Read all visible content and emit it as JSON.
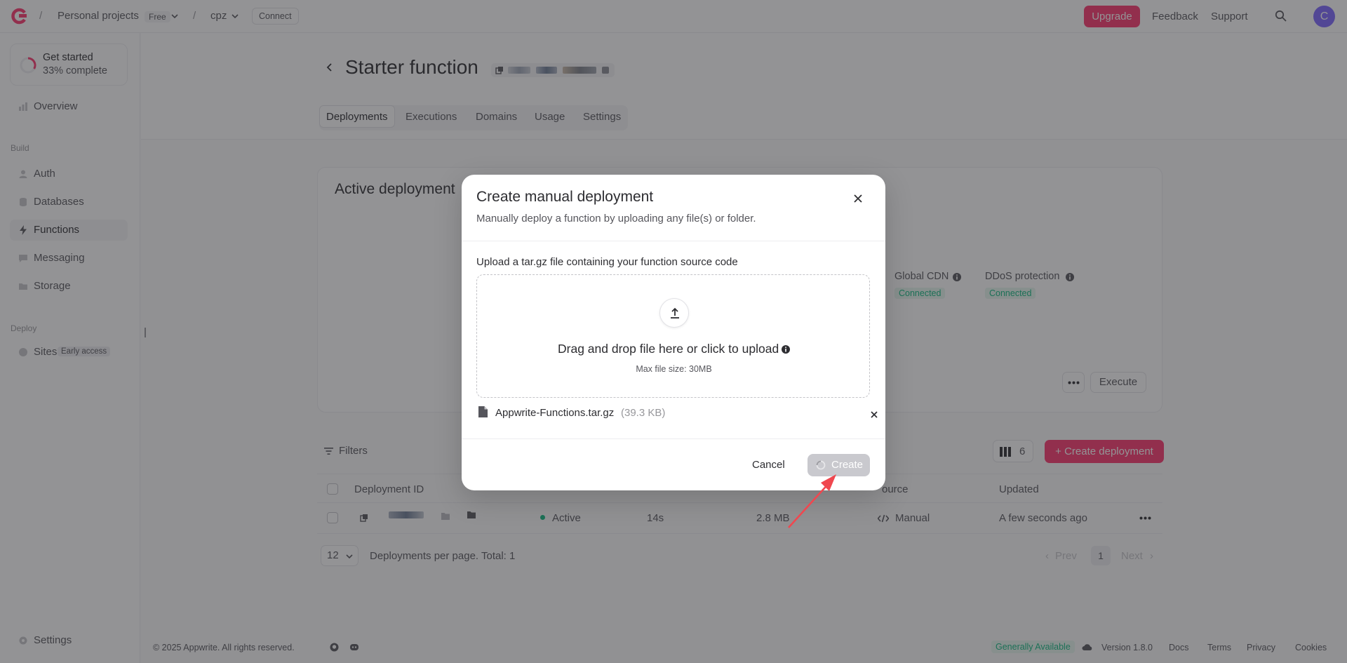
{
  "topbar": {
    "org": "Personal projects",
    "plan_badge": "Free",
    "project": "cpz",
    "connect_label": "Connect",
    "upgrade_label": "Upgrade",
    "feedback_label": "Feedback",
    "support_label": "Support",
    "avatar_initial": "C",
    "brand_color": "#fd366e"
  },
  "sidebar": {
    "get_started": {
      "title": "Get started",
      "progress_text": "33% complete",
      "progress": 0.33
    },
    "overview": "Overview",
    "build_section": "Build",
    "items_build": [
      "Auth",
      "Databases",
      "Functions",
      "Messaging",
      "Storage"
    ],
    "deploy_section": "Deploy",
    "sites": {
      "label": "Sites",
      "badge": "Early access"
    },
    "settings": "Settings",
    "active_item": "Functions"
  },
  "page": {
    "title": "Starter function",
    "tabs": [
      "Deployments",
      "Executions",
      "Domains",
      "Usage",
      "Settings"
    ],
    "active_tab": "Deployments"
  },
  "active_deployment": {
    "title": "Active deployment",
    "global_cdn": {
      "label": "Global CDN",
      "status": "Connected"
    },
    "ddos": {
      "label": "DDoS protection",
      "status": "Connected"
    },
    "execute_label": "Execute"
  },
  "deployments": {
    "filters_label": "Filters",
    "columns_count": "6",
    "create_label": "Create deployment",
    "headers": {
      "id": "Deployment ID",
      "source": "ource",
      "updated": "Updated"
    },
    "row": {
      "status": "Active",
      "build_time": "14s",
      "size": "2.8 MB",
      "source": "Manual",
      "updated": "A few seconds ago"
    },
    "per_page": "12",
    "per_page_text": "Deployments per page. Total: 1",
    "prev": "Prev",
    "page": "1",
    "next": "Next"
  },
  "footer": {
    "copyright": "© 2025 Appwrite. All rights reserved.",
    "availability": "Generally Available",
    "version": "Version 1.8.0",
    "links": [
      "Docs",
      "Terms",
      "Privacy",
      "Cookies"
    ]
  },
  "modal": {
    "title": "Create manual deployment",
    "subtitle": "Manually deploy a function by uploading any file(s) or folder.",
    "upload_label": "Upload a tar.gz file containing your function source code",
    "dropzone_text": "Drag and drop file here or click to upload",
    "max_size": "Max file size: 30MB",
    "file_name": "Appwrite-Functions.tar.gz",
    "file_size": "(39.3 KB)",
    "cancel_label": "Cancel",
    "create_label": "Create"
  }
}
